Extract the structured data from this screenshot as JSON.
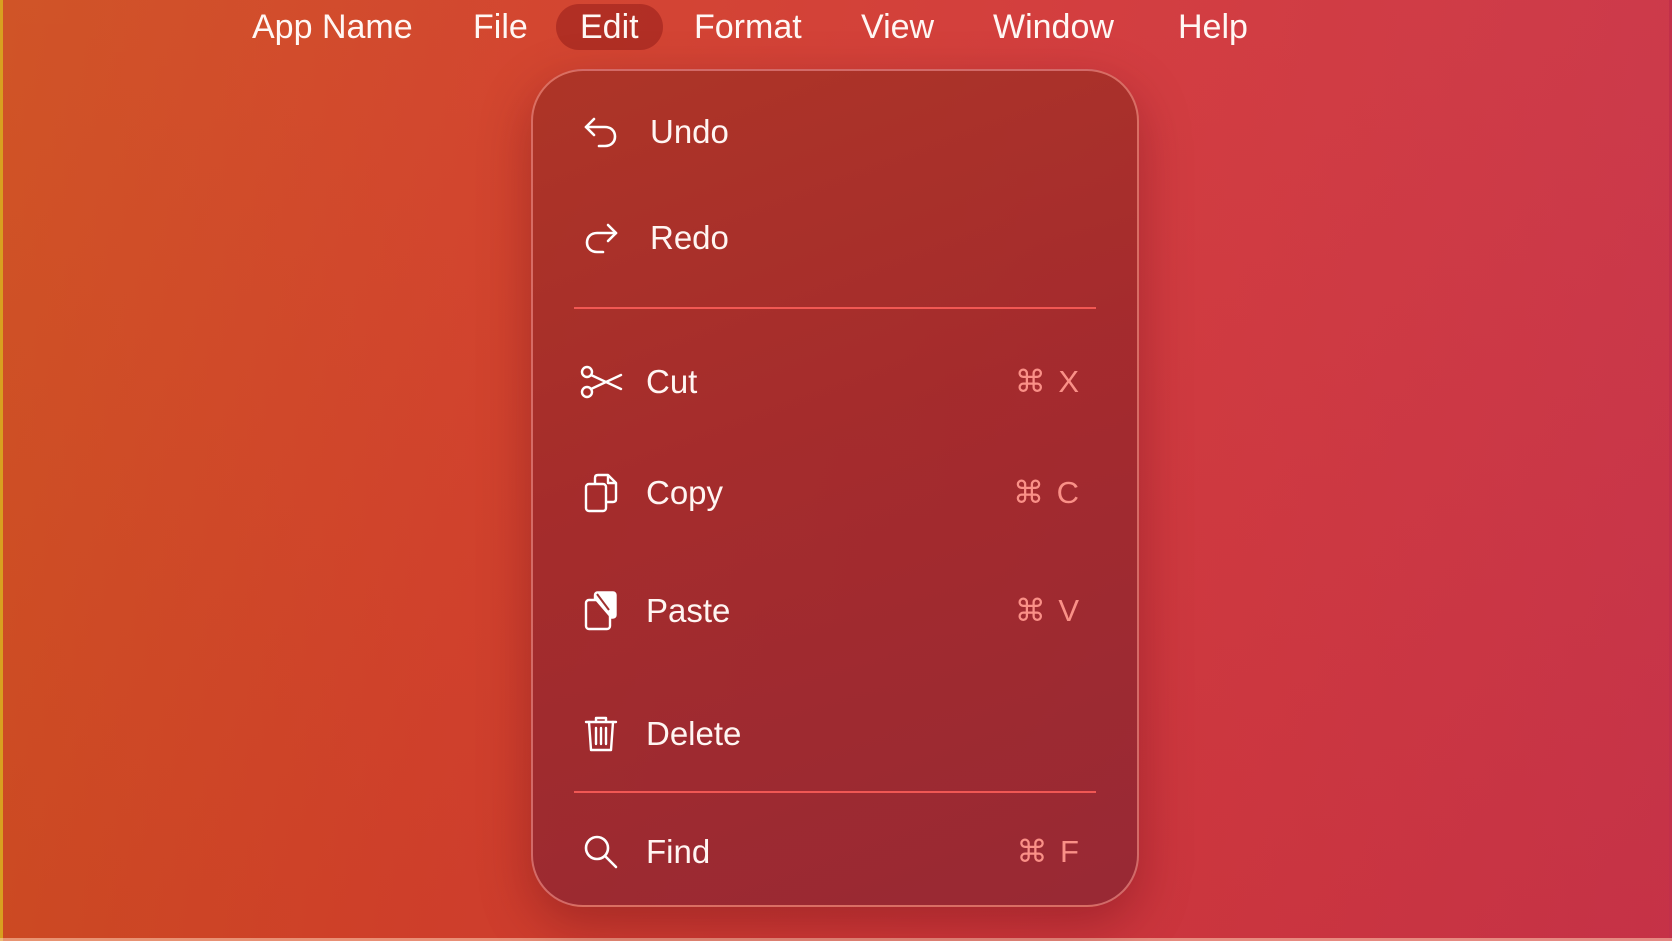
{
  "menubar": {
    "items": [
      {
        "label": "App Name",
        "active": false
      },
      {
        "label": "File",
        "active": false
      },
      {
        "label": "Edit",
        "active": true
      },
      {
        "label": "Format",
        "active": false
      },
      {
        "label": "View",
        "active": false
      },
      {
        "label": "Window",
        "active": false
      },
      {
        "label": "Help",
        "active": false
      }
    ]
  },
  "edit_menu": {
    "items": [
      {
        "label": "Undo",
        "icon": "undo-icon",
        "shortcut": ""
      },
      {
        "label": "Redo",
        "icon": "redo-icon",
        "shortcut": ""
      },
      {
        "label": "Cut",
        "icon": "scissors-icon",
        "shortcut": "⌘ X"
      },
      {
        "label": "Copy",
        "icon": "copy-icon",
        "shortcut": "⌘ C"
      },
      {
        "label": "Paste",
        "icon": "paste-icon",
        "shortcut": "⌘ V"
      },
      {
        "label": "Delete",
        "icon": "trash-icon",
        "shortcut": ""
      },
      {
        "label": "Find",
        "icon": "search-icon",
        "shortcut": "⌘ F"
      }
    ]
  },
  "colors": {
    "background_start": "#cf4f20",
    "background_end": "#c93348",
    "menu_panel": "#a0302e",
    "separator": "#ff5f5a",
    "shortcut_text": "#ff968c"
  }
}
